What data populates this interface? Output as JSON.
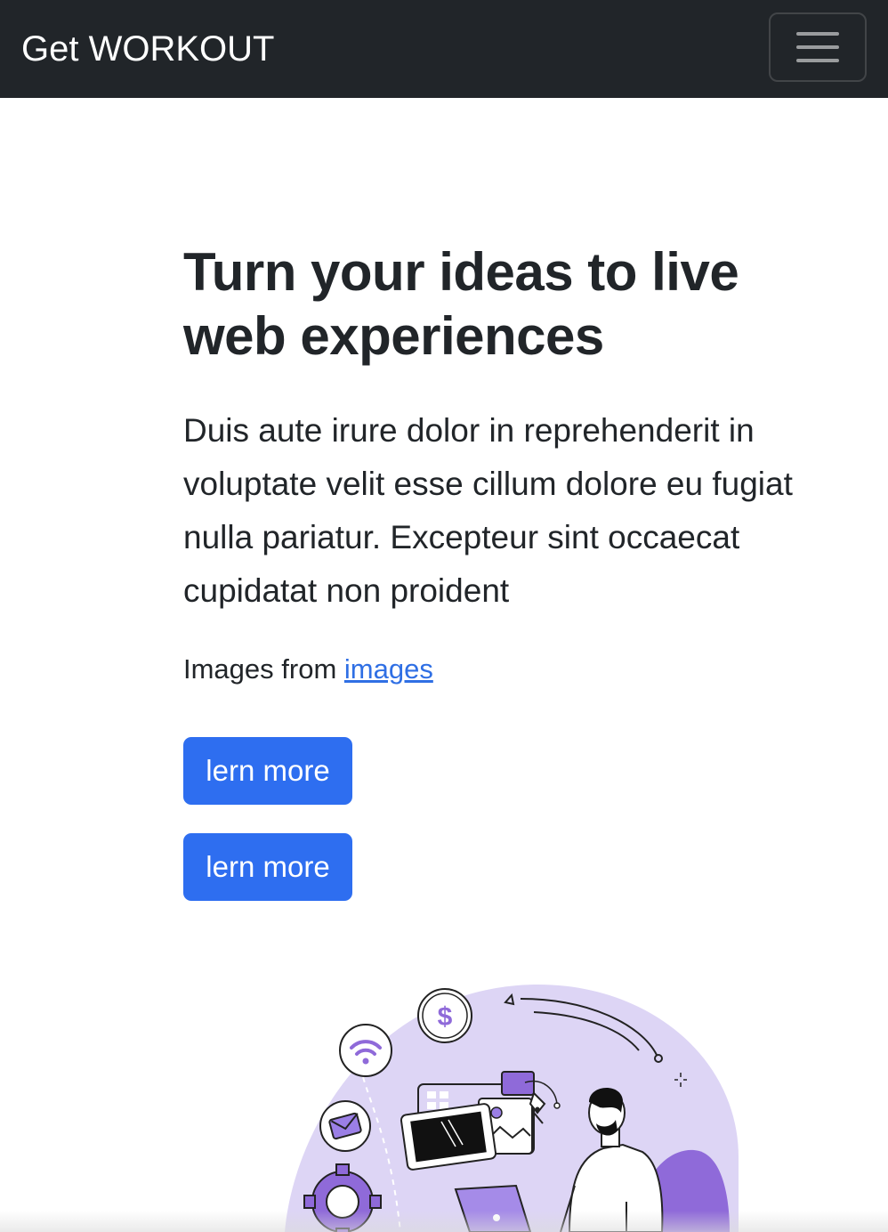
{
  "navbar": {
    "brand": "Get WORKOUT",
    "toggler_icon": "hamburger-menu-icon",
    "background_color": "#212529"
  },
  "hero": {
    "title": "Turn your ideas to live web experiences",
    "lead": "Duis aute irure dolor in reprehenderit in voluptate velit esse cillum dolore eu fugiat nulla pariatur. Excepteur sint occaecat cupidatat non proident",
    "credit_prefix": "Images from ",
    "credit_link": "images",
    "link_color": "#2f6fe4"
  },
  "buttons": [
    {
      "label": "lern more"
    },
    {
      "label": "lern more"
    }
  ],
  "button_color": "#2e6ef0",
  "illustration": {
    "icons": [
      "dollar-icon",
      "wifi-icon",
      "mail-icon",
      "gear-icon",
      "browser-window-icon",
      "laptop-icon",
      "person-icon",
      "pen-tool-icon"
    ],
    "accent_color": "#9b7fe6",
    "blob_color": "#ddd5f5"
  }
}
